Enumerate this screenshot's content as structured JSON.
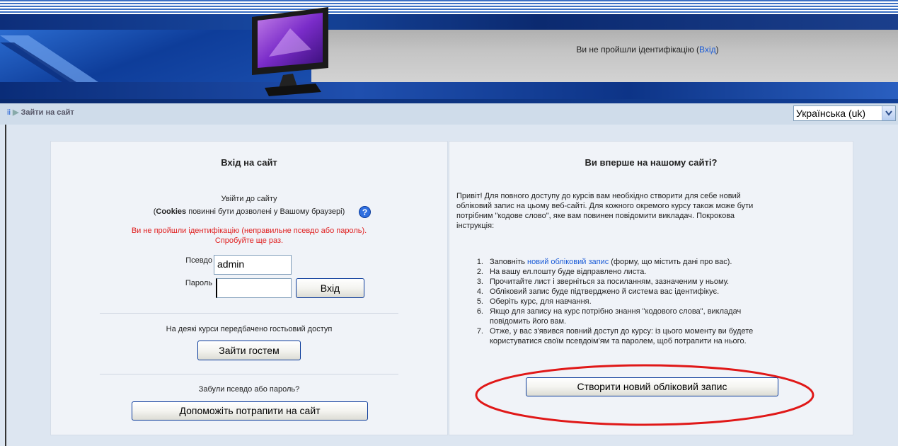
{
  "header": {
    "auth_text": "Ви не пройшли ідентифікацію (",
    "login_link": "Вхід",
    "auth_close": ")"
  },
  "nav": {
    "home_link": "ii",
    "breadcrumb_current": "Зайти на сайт",
    "language_selected": "Українська (uk)"
  },
  "login": {
    "title": "Вхід на сайт",
    "subtitle": "Увійти до сайту",
    "cookies_bold": "Cookies",
    "cookies_rest": " повинні бути дозволені у Вашому браузері)",
    "cookies_open": "(",
    "error_line1": "Ви не пройшли ідентифікацію (неправильне псевдо або пароль).",
    "error_line2": "Спробуйте ще раз.",
    "username_label": "Псевдо",
    "username_value": "admin",
    "password_label": "Пароль",
    "password_value": "",
    "login_button": "Вхід",
    "guest_text": "На деякі курси передбачено гостьовий доступ",
    "guest_button": "Зайти гостем",
    "forgot_text": "Забули псевдо або пароль?",
    "forgot_button": "Допоможіть потрапити на сайт"
  },
  "signup": {
    "title": "Ви вперше на нашому сайті?",
    "intro_1": "Привіт! Для повного доступу до курсів вам необхідно створити для себе новий",
    "intro_2": "обліковий запис на цьому веб-сайті. Для кожного окремого курсу також може бути",
    "intro_3": "потрібним \"кодове слово\", яке вам повинен повідомити викладач. Покрокова",
    "intro_4": "інструкція:",
    "step1_pre": "Заповніть ",
    "step1_link": "новий обліковий запис",
    "step1_post": " (форму, що містить дані про вас).",
    "steps": [
      {
        "n": "1.",
        "text": ""
      },
      {
        "n": "2.",
        "text": "На вашу ел.пошту буде відправлено листа."
      },
      {
        "n": "3.",
        "text": "Прочитайте лист і зверніться за посиланням, зазначеним у ньому."
      },
      {
        "n": "4.",
        "text": "Обліковий запис буде підтверджено й система вас ідентифікує."
      },
      {
        "n": "5.",
        "text": "Оберіть курс, для навчання."
      },
      {
        "n": "6.",
        "text": "Якщо для запису на курс потрібно знання \"кодового слова\", викладач"
      },
      {
        "n": "",
        "text": "повідомить його вам."
      },
      {
        "n": "7.",
        "text": "Отже, у вас з'явився повний доступ до курсу: із цього моменту ви будете"
      },
      {
        "n": "",
        "text": "користуватися своїм псевдоім'ям та паролем, щоб потрапити на нього."
      }
    ],
    "create_button": "Створити новий обліковий запис"
  },
  "colors": {
    "highlight_ellipse": "#e01818",
    "link": "#1a5bd6",
    "error": "#e02020"
  }
}
